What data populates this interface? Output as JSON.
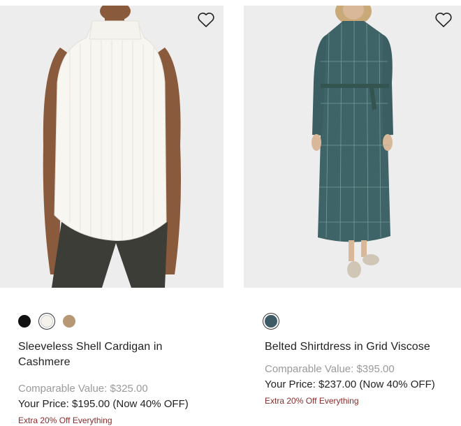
{
  "products": [
    {
      "name": "Sleeveless Shell Cardigan in Cashmere",
      "swatches": [
        {
          "color": "#111111",
          "label": "black"
        },
        {
          "color": "#f4f2ea",
          "label": "ivory"
        },
        {
          "color": "#b89774",
          "label": "camel"
        }
      ],
      "selected_swatch": "ivory",
      "comparable_value": "Comparable Value: $325.00",
      "your_price": "Your Price: $195.00 (Now 40% OFF)",
      "promo": "Extra 20% Off Everything",
      "wishlist_icon": "heart-outline-icon"
    },
    {
      "name": "Belted Shirtdress in Grid Viscose",
      "swatches": [
        {
          "color": "#3d5a66",
          "label": "teal-grid"
        }
      ],
      "selected_swatch": "teal-grid",
      "comparable_value": "Comparable Value: $395.00",
      "your_price": "Your Price: $237.00 (Now 40% OFF)",
      "promo": "Extra 20% Off Everything",
      "wishlist_icon": "heart-outline-icon"
    }
  ],
  "colors": {
    "image_background": "#ededed",
    "promo_red": "#8b2b2b",
    "muted_gray": "#9a9a9a"
  }
}
